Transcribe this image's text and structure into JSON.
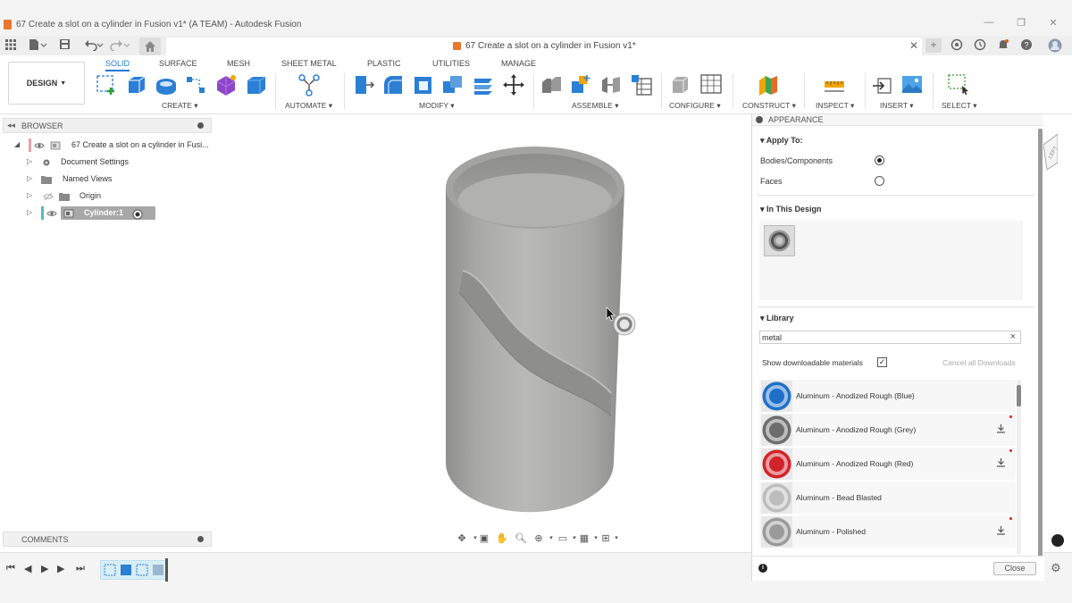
{
  "window": {
    "title": "67 Create a slot on a cylinder in Fusion v1* (A TEAM) - Autodesk Fusion",
    "minimize": "—",
    "maximize": "❐",
    "close": "✕"
  },
  "doc_tab": {
    "title": "67 Create a slot on a cylinder in Fusion v1*",
    "close": "✕"
  },
  "toolbar": {
    "workspace": "DESIGN",
    "tabs": [
      "SOLID",
      "SURFACE",
      "MESH",
      "SHEET METAL",
      "PLASTIC",
      "UTILITIES",
      "MANAGE"
    ],
    "active_tab": "SOLID",
    "groups": {
      "create": "CREATE",
      "automate": "AUTOMATE",
      "modify": "MODIFY",
      "assemble": "ASSEMBLE",
      "configure": "CONFIGURE",
      "construct": "CONSTRUCT",
      "inspect": "INSPECT",
      "insert": "INSERT",
      "select": "SELECT"
    },
    "accent": "#1f7ad6"
  },
  "browser": {
    "header": "BROWSER",
    "items": [
      {
        "label": "67 Create a slot on a cylinder in Fusi..."
      },
      {
        "label": "Document Settings"
      },
      {
        "label": "Named Views"
      },
      {
        "label": "Origin"
      },
      {
        "label": "Cylinder:1"
      }
    ]
  },
  "comments": {
    "header": "COMMENTS"
  },
  "appearance": {
    "header": "APPEARANCE",
    "apply_to": {
      "title": "Apply To:",
      "options": [
        {
          "label": "Bodies/Components",
          "selected": true
        },
        {
          "label": "Faces",
          "selected": false
        }
      ]
    },
    "in_this_design": {
      "title": "In This Design"
    },
    "library": {
      "title": "Library",
      "search_value": "metal",
      "clear": "×",
      "show_downloadable_label": "Show downloadable materials",
      "show_downloadable_checked": true,
      "cancel_downloads": "Cancel all Downloads",
      "materials": [
        {
          "name": "Aluminum - Anodized Rough (Blue)",
          "color": "#1f6fc8",
          "download": false
        },
        {
          "name": "Aluminum - Anodized Rough (Grey)",
          "color": "#6d6d6d",
          "download": true
        },
        {
          "name": "Aluminum - Anodized Rough (Red)",
          "color": "#d0232a",
          "download": true
        },
        {
          "name": "Aluminum - Bead Blasted",
          "color": "#bdbdbd",
          "download": false
        },
        {
          "name": "Aluminum - Polished",
          "color": "#9a9a9a",
          "download": true
        }
      ]
    },
    "close": "Close"
  }
}
